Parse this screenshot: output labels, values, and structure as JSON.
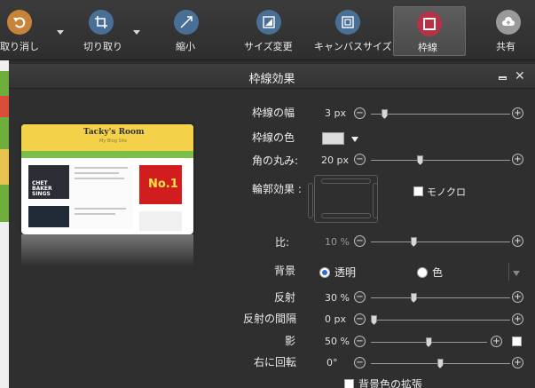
{
  "toolbar": {
    "undo": "取り消し",
    "crop": "切り取り",
    "shrink": "縮小",
    "resize": "サイズ変更",
    "canvas_size": "キャンバスサイズ",
    "border": "枠線",
    "share": "共有"
  },
  "dialog": {
    "title": "枠線効果"
  },
  "preview": {
    "site_title": "Tacky's Room",
    "site_subtitle": "My Blog Site",
    "image_text": "CHET BAKER SINGS",
    "ad_text": "No.1"
  },
  "settings": {
    "border_width": {
      "label": "枠線の幅",
      "value": "3 px",
      "fraction": 0.08
    },
    "border_color": {
      "label": "枠線の色",
      "color": "#dcdcdc"
    },
    "corner_radius": {
      "label": "角の丸み:",
      "value": "20 px",
      "fraction": 0.35
    },
    "outline_effect": {
      "label": "輪郭効果 :",
      "mono_label": "モノクロ"
    },
    "ratio": {
      "label": "比:",
      "value": "10 %",
      "fraction": 0.3
    },
    "background": {
      "label": "背景",
      "option_transparent": "透明",
      "option_color": "色"
    },
    "reflection": {
      "label": "反射",
      "value": "30 %",
      "fraction": 0.3
    },
    "reflection_gap": {
      "label": "反射の間隔",
      "value": "0 px",
      "fraction": 0.0
    },
    "shadow": {
      "label": "影",
      "value": "50 %",
      "fraction": 0.5
    },
    "rotate_right": {
      "label": "右に回転",
      "value": "0°",
      "fraction": 0.5
    },
    "extend_bg": {
      "label": "背景色の拡張"
    }
  },
  "colors": {
    "undo_icon": "#c8833a",
    "tool_icon": "#4a6f96",
    "border_icon": "#b83247",
    "share_icon": "#9a9a9a",
    "radio_selected": "#2a6fd6"
  },
  "icons": [
    "undo-icon",
    "crop-icon",
    "shrink-icon",
    "resize-icon",
    "canvas-size-icon",
    "border-icon",
    "share-cloud-icon"
  ]
}
